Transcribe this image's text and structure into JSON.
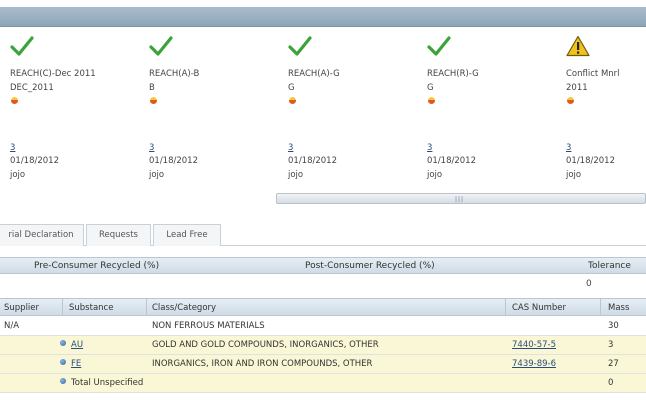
{
  "cards": [
    {
      "status": "pass",
      "name": "REACH(C)-Dec 2011",
      "code": "DEC_2011",
      "count": "3",
      "date": "01/18/2012",
      "user": "jojo"
    },
    {
      "status": "pass",
      "name": "REACH(A)-B",
      "code": "B",
      "count": "3",
      "date": "01/18/2012",
      "user": "jojo"
    },
    {
      "status": "pass",
      "name": "REACH(A)-G",
      "code": "G",
      "count": "3",
      "date": "01/18/2012",
      "user": "jojo"
    },
    {
      "status": "pass",
      "name": "REACH(R)-G",
      "code": "G",
      "count": "3",
      "date": "01/18/2012",
      "user": "jojo"
    },
    {
      "status": "warning",
      "name": "Conflict Mnrl",
      "code": "2011",
      "count": "3",
      "date": "01/18/2012",
      "user": "jojo"
    }
  ],
  "tabs": [
    "rial Declaration",
    "Requests",
    "Lead Free"
  ],
  "recycled": {
    "pre_label": "Pre-Consumer Recycled (%)",
    "post_label": "Post-Consumer Recycled (%)",
    "tolerance_label": "Tolerance",
    "tolerance_value": "0"
  },
  "substances": {
    "headers": {
      "supplier": "Supplier",
      "substance": "Substance",
      "class": "Class/Category",
      "cas": "CAS Number",
      "mass": "Mass"
    },
    "rows": [
      {
        "supplier": "N/A",
        "substance": "",
        "class": "NON FERROUS MATERIALS",
        "cas": "",
        "mass": "30"
      },
      {
        "supplier": "",
        "substance": "AU",
        "class": "GOLD AND GOLD COMPOUNDS, INORGANICS, OTHER",
        "cas": "7440-57-5",
        "mass": "3"
      },
      {
        "supplier": "",
        "substance": "FE",
        "class": "INORGANICS, IRON AND IRON COMPOUNDS, OTHER",
        "cas": "7439-89-6",
        "mass": "27"
      },
      {
        "supplier": "",
        "substance": "Total Unspecified",
        "class": "",
        "cas": "",
        "mass": "0"
      }
    ]
  },
  "colors": {
    "check": "#3aa33a",
    "warning": "#f2c21a",
    "header": "#cfdbe6",
    "highlight": "#f9f7d6"
  }
}
